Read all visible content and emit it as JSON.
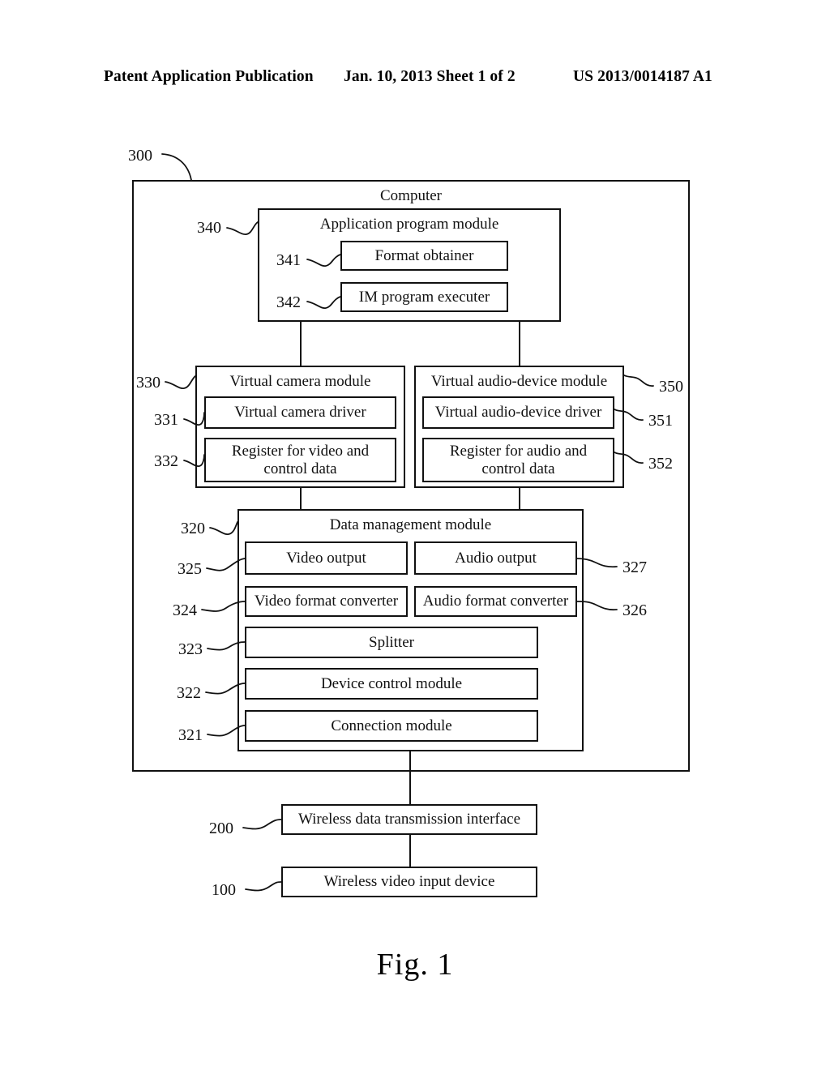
{
  "header": {
    "left": "Patent Application Publication",
    "middle": "Jan. 10, 2013  Sheet 1 of 2",
    "right": "US 2013/0014187 A1"
  },
  "figure": {
    "caption": "Fig. 1",
    "blocks": {
      "computer": "Computer",
      "application_program_module": "Application program module",
      "format_obtainer": "Format obtainer",
      "im_program_executer": "IM program executer",
      "virtual_camera_module": "Virtual camera module",
      "virtual_camera_driver": "Virtual camera driver",
      "register_video": "Register for video and control data",
      "virtual_audio_device_module": "Virtual audio-device module",
      "virtual_audio_device_driver": "Virtual audio-device driver",
      "register_audio": "Register for audio and control data",
      "data_management_module": "Data management module",
      "video_output": "Video output",
      "audio_output": "Audio output",
      "video_format_converter": "Video format converter",
      "audio_format_converter": "Audio format converter",
      "splitter": "Splitter",
      "device_control_module": "Device control module",
      "connection_module": "Connection module",
      "wireless_data_transmission_interface": "Wireless data transmission interface",
      "wireless_video_input_device": "Wireless video input device"
    },
    "refs": {
      "computer": "300",
      "application_program_module": "340",
      "format_obtainer": "341",
      "im_program_executer": "342",
      "virtual_camera_module": "330",
      "virtual_camera_driver": "331",
      "register_video": "332",
      "virtual_audio_device_module": "350",
      "virtual_audio_device_driver": "351",
      "register_audio": "352",
      "data_management_module": "320",
      "video_output": "325",
      "audio_output": "327",
      "video_format_converter": "324",
      "audio_format_converter": "326",
      "splitter": "323",
      "device_control_module": "322",
      "connection_module": "321",
      "wireless_data_transmission_interface": "200",
      "wireless_video_input_device": "100"
    }
  }
}
